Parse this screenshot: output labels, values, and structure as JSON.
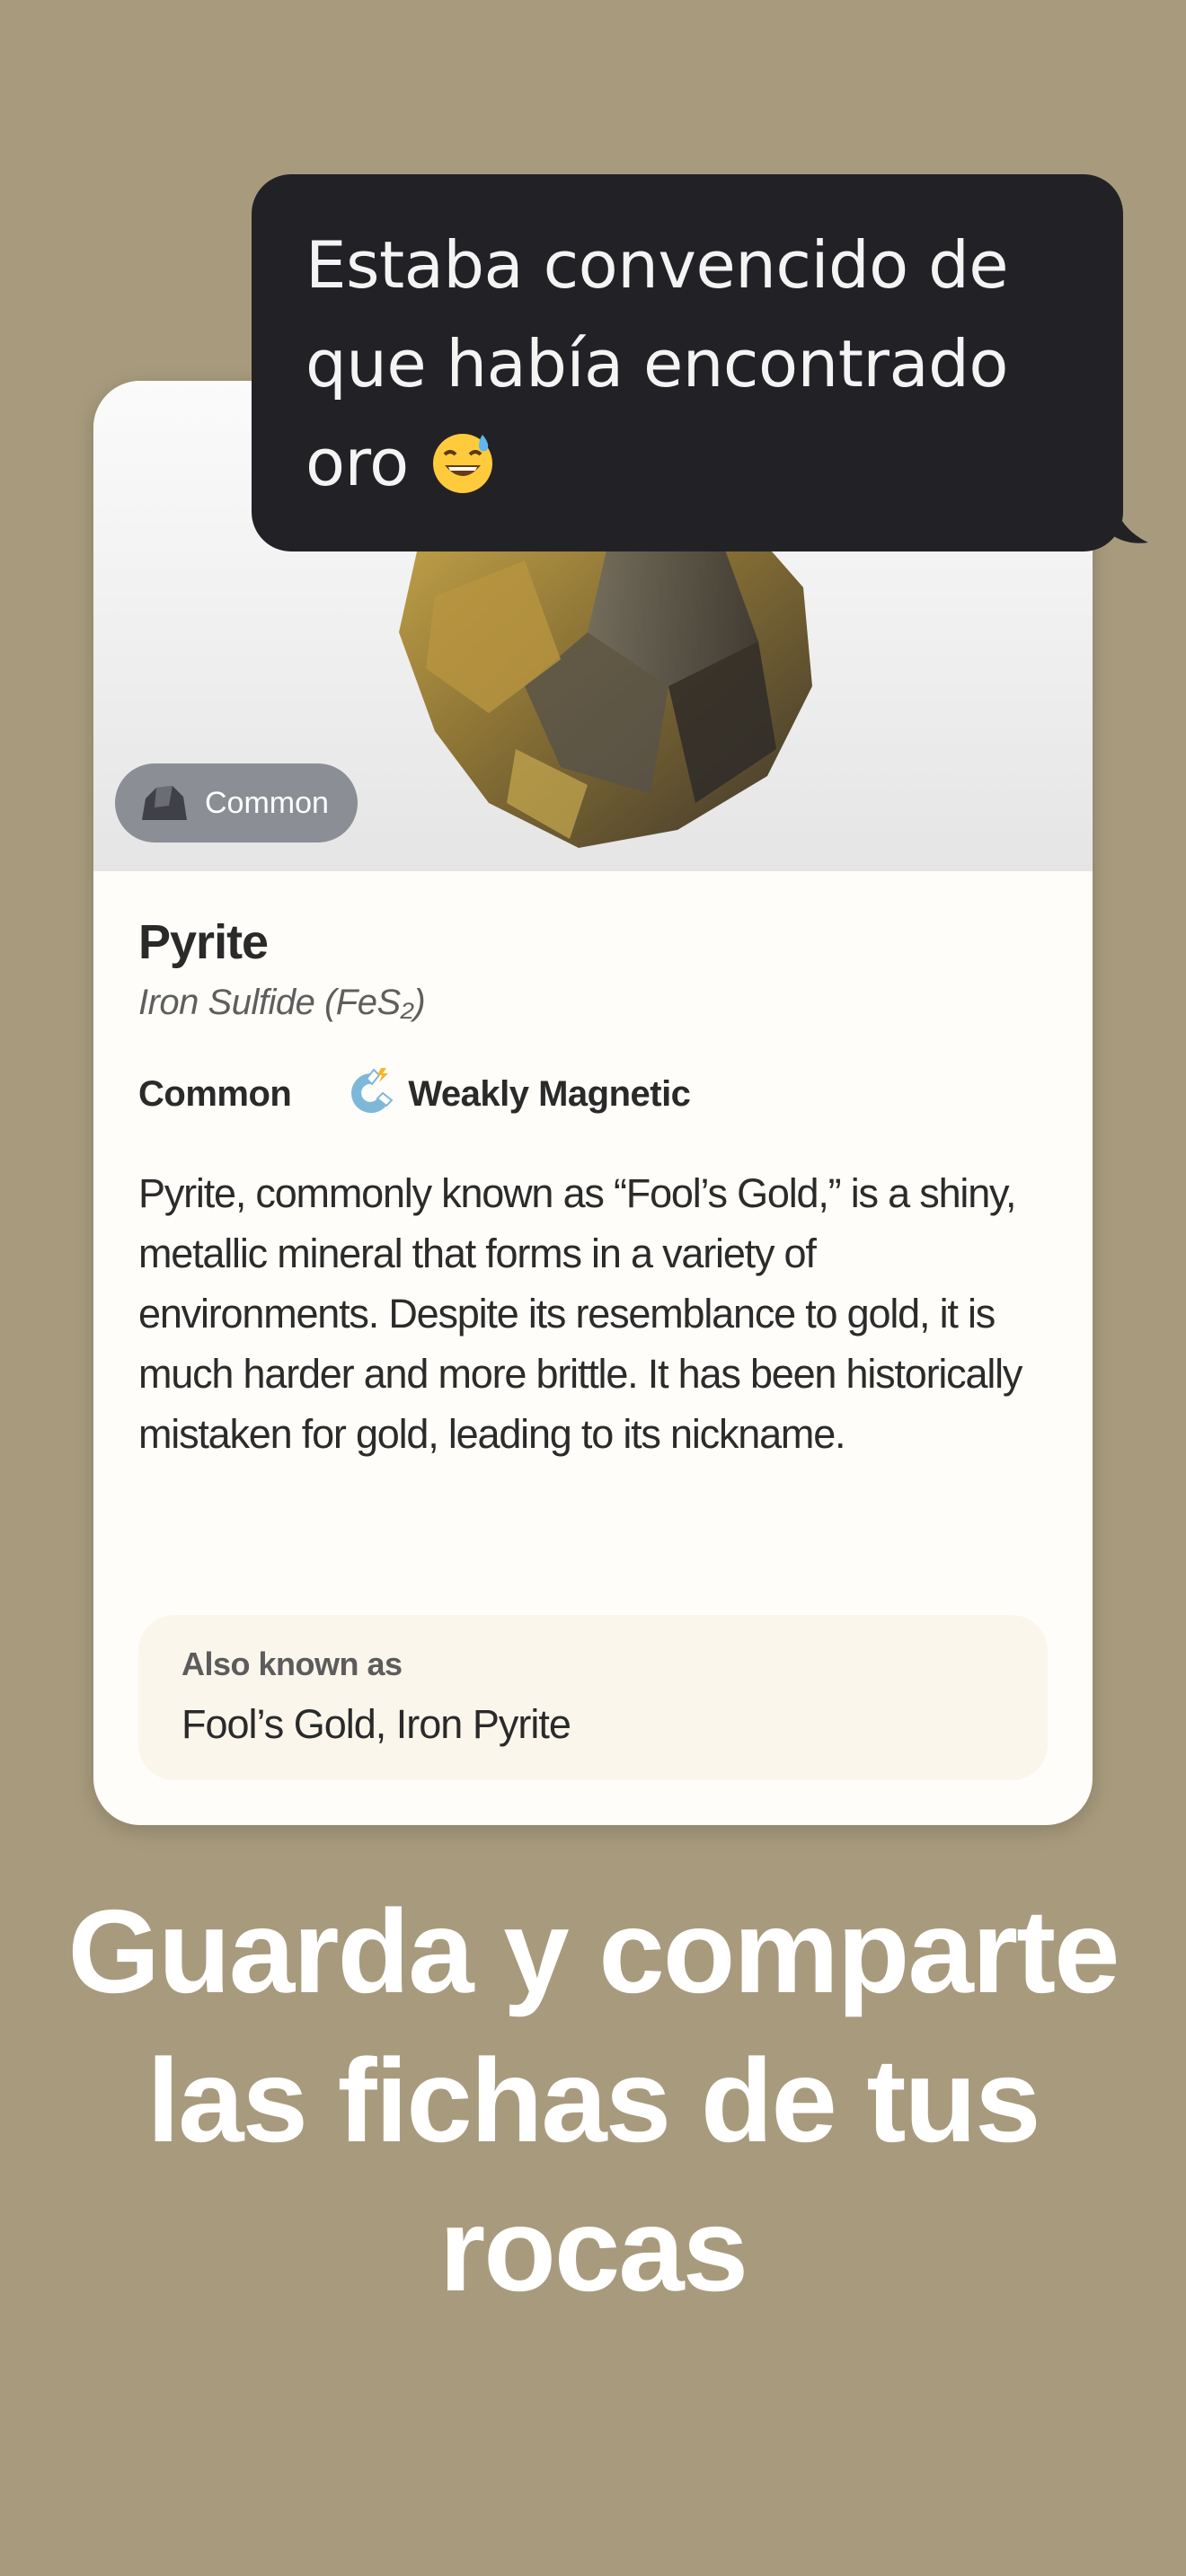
{
  "chat_bubble": {
    "text": "Estaba convencido de que había encontrado oro",
    "emoji": "grinning-face-with-sweat"
  },
  "card": {
    "rarity_badge": "Common",
    "name": "Pyrite",
    "scientific_name": "Iron Sulfide (FeS₂)",
    "tags": {
      "rarity": "Common",
      "magnetism": "Weakly Magnetic",
      "magnetism_icon": "magnet-icon"
    },
    "description": "Pyrite, commonly known as “Fool’s Gold,” is a shiny, metallic mineral that forms in a variety of environments. Despite its resemblance to gold, it is much harder and more brittle. It has been historically mistaken for gold, leading to its nickname.",
    "also_known_as": {
      "title": "Also known as",
      "value": "Fool’s Gold, Iron Pyrite"
    }
  },
  "headline": "Guarda y comparte las fichas de tus rocas",
  "colors": {
    "background": "#A89B7D",
    "card": "#FEFDF9",
    "bubble": "#222226",
    "pill": "#8B8E94"
  }
}
